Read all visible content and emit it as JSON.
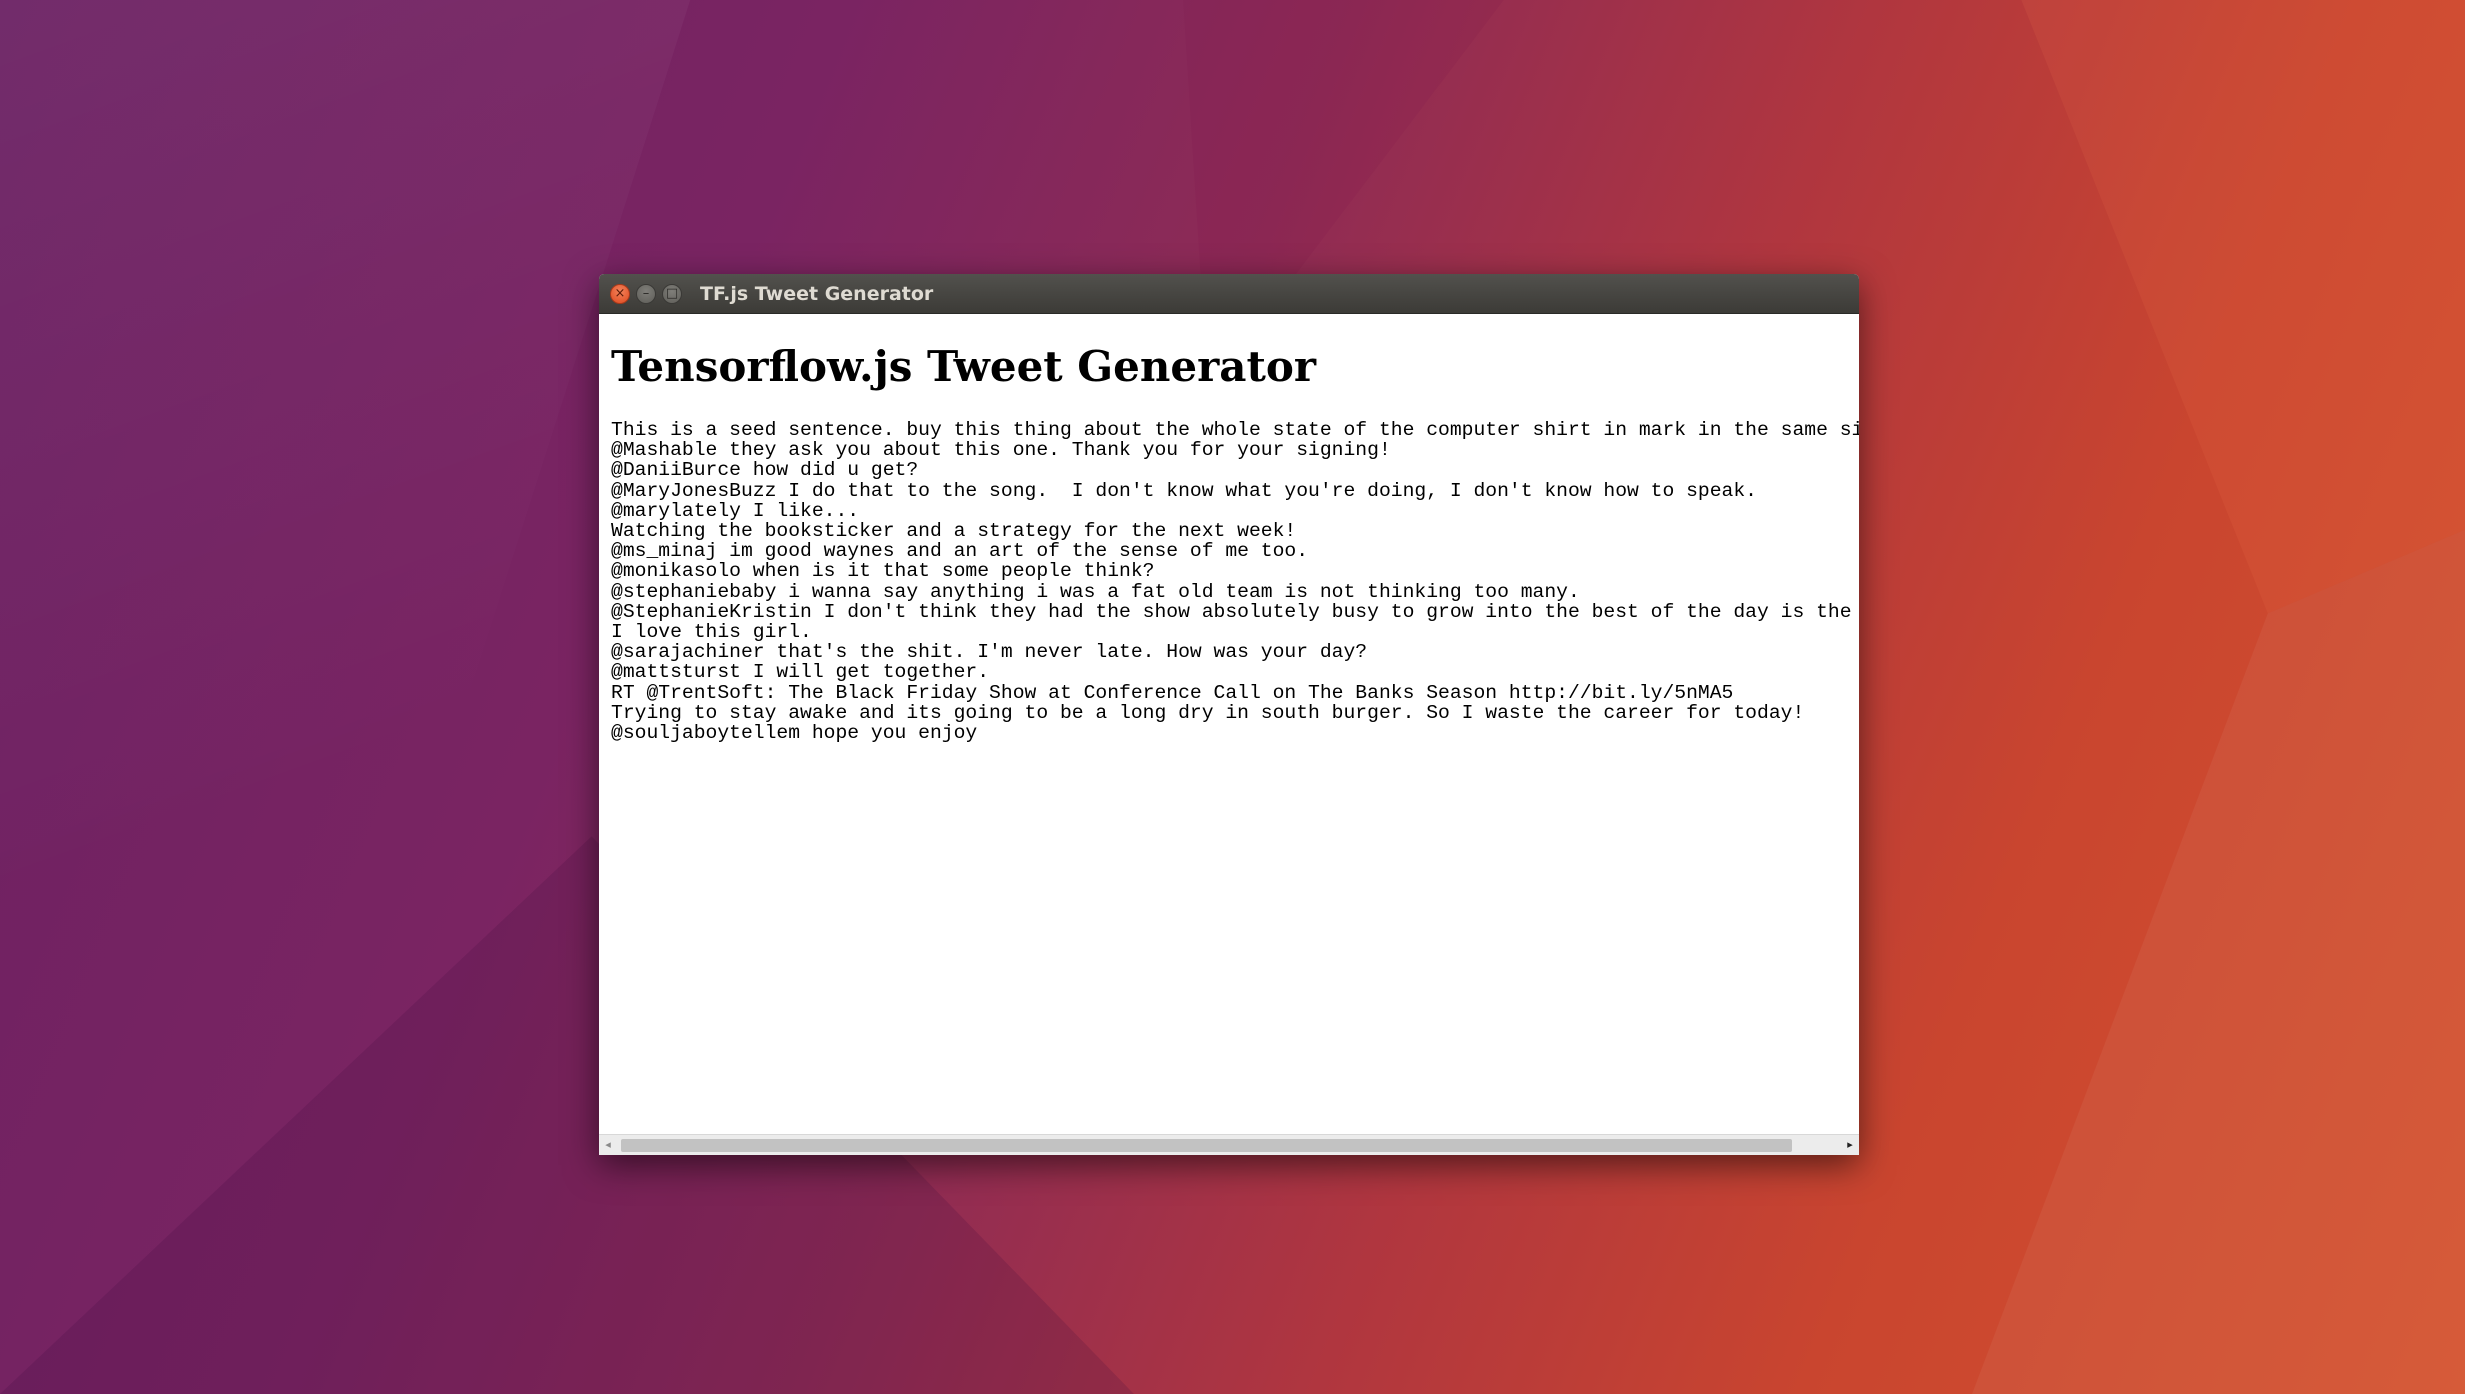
{
  "desktop": {
    "wallpaper": "ubuntu-warty-final-gradient",
    "colors": {
      "purple": "#6b2163",
      "magenta": "#8e2b55",
      "orange": "#d4532f"
    }
  },
  "window": {
    "title": "TF.js Tweet Generator",
    "controls": {
      "close_icon": "×",
      "minimize_icon": "–",
      "maximize_icon": "□"
    },
    "colors": {
      "titlebar": "#3c3b37",
      "close": "#df4a20"
    }
  },
  "page": {
    "heading": "Tensorflow.js Tweet Generator",
    "generated_text": "This is a seed sentence. buy this thing about the whole state of the computer shirt in mark in the same single thou\n@Mashable they ask you about this one. Thank you for your signing!\n@DaniiBurce how did u get?\n@MaryJonesBuzz I do that to the song.  I don't know what you're doing, I don't know how to speak.\n@marylately I like...\nWatching the booksticker and a strategy for the next week!\n@ms_minaj im good waynes and an art of the sense of me too.\n@monikasolo when is it that some people think?\n@stephaniebaby i wanna say anything i was a fat old team is not thinking too many.\n@StephanieKristin I don't think they had the show absolutely busy to grow into the best of the day is the on the re\nI love this girl.\n@sarajachiner that's the shit. I'm never late. How was your day?\n@mattsturst I will get together.\nRT @TrentSoft: The Black Friday Show at Conference Call on The Banks Season http://bit.ly/5nMA5\nTrying to stay awake and its going to be a long dry in south burger. So I waste the career for today!\n@souljaboytellem hope you enjoy"
  },
  "scrollbar": {
    "left_arrow": "◂",
    "right_arrow": "▸"
  }
}
